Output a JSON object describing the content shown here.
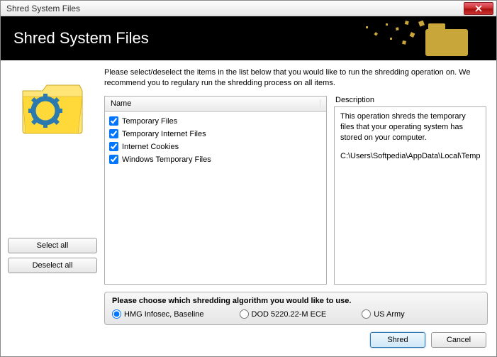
{
  "window": {
    "title": "Shred System Files"
  },
  "header": {
    "title": "Shred System Files"
  },
  "instruction": "Please select/deselect the items in the list below that you would like to run the shredding operation on. We recommend you to regulary run the shredding process on all items.",
  "list": {
    "header": "Name",
    "items": [
      {
        "label": "Temporary Files",
        "checked": true
      },
      {
        "label": "Temporary Internet Files",
        "checked": true
      },
      {
        "label": "Internet Cookies",
        "checked": true
      },
      {
        "label": "Windows Temporary Files",
        "checked": true
      }
    ]
  },
  "description": {
    "label": "Description",
    "text": "This operation shreds the temporary files that your operating system has stored on your computer.",
    "path": "C:\\Users\\Softpedia\\AppData\\Local\\Temp"
  },
  "side_buttons": {
    "select_all": "Select all",
    "deselect_all": "Deselect all"
  },
  "algorithm": {
    "title": "Please choose which shredding algorithm you would like to use.",
    "options": [
      {
        "label": "HMG Infosec, Baseline",
        "selected": true
      },
      {
        "label": "DOD 5220.22-M ECE",
        "selected": false
      },
      {
        "label": "US Army",
        "selected": false
      }
    ]
  },
  "footer": {
    "shred": "Shred",
    "cancel": "Cancel"
  }
}
